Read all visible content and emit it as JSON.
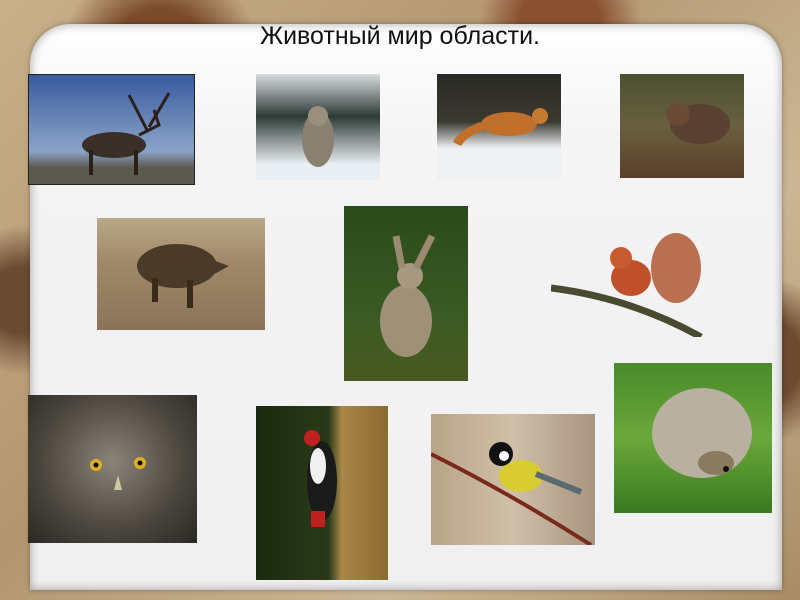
{
  "slide": {
    "title": "Животный мир области."
  },
  "photos": [
    {
      "animal": "reindeer"
    },
    {
      "animal": "wolf"
    },
    {
      "animal": "fox"
    },
    {
      "animal": "bear"
    },
    {
      "animal": "wild-boar"
    },
    {
      "animal": "hare"
    },
    {
      "animal": "squirrel"
    },
    {
      "animal": "owl"
    },
    {
      "animal": "woodpecker"
    },
    {
      "animal": "great-tit"
    },
    {
      "animal": "hedgehog"
    }
  ]
}
